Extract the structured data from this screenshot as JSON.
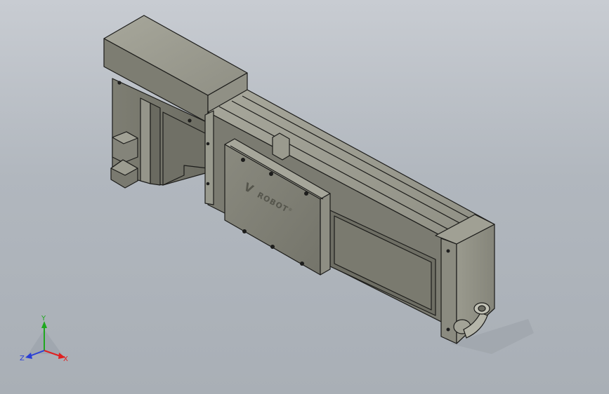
{
  "model": {
    "logo_text": "ROBOT",
    "logo_mark": "V",
    "logo_registered": "®"
  },
  "triad": {
    "x_label": "X",
    "y_label": "Y",
    "z_label": "Z",
    "x_color": "#e02020",
    "y_color": "#1fa81f",
    "z_color": "#2a3fd6"
  },
  "colors": {
    "body": "#8c8c80",
    "body_dark": "#6f6f65",
    "body_light": "#a3a397",
    "edge": "#1c1c1a"
  }
}
